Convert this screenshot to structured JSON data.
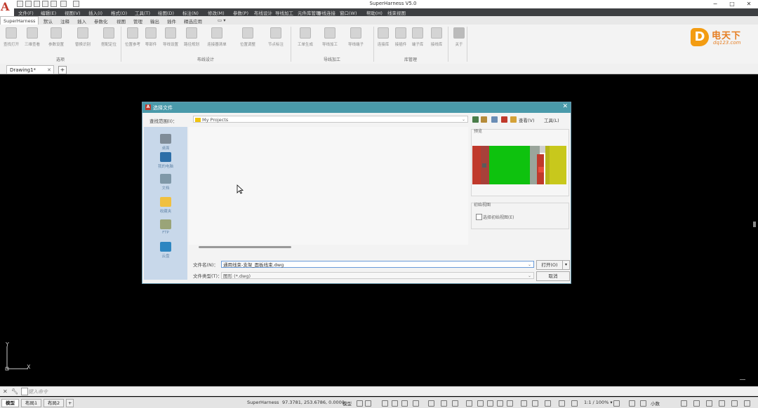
{
  "app": {
    "title": "SuperHarness V5.0",
    "window_controls": [
      "−",
      "□",
      "✕"
    ]
  },
  "menubar": [
    "文件(F)",
    "编辑(E)",
    "视图(V)",
    "插入(I)",
    "格式(O)",
    "工具(T)",
    "绘图(D)",
    "标注(N)",
    "修改(M)",
    "参数(P)",
    "布线设计",
    "导线加工",
    "元件库管理",
    "导线连接",
    "窗口(W)",
    "帮助(H)",
    "线束视图"
  ],
  "ribbon_tabs": {
    "active": "SuperHarness",
    "items": [
      "默认",
      "注释",
      "插入",
      "参数化",
      "视图",
      "管理",
      "输出",
      "插件",
      "精选应用",
      "▭ ▾"
    ]
  },
  "ribbon": {
    "buttons": [
      "查找打开",
      "三维查看",
      "参数设置",
      "替换识别",
      "搭配定位",
      "位置参考",
      "零部件",
      "导线设置",
      "路径规划",
      "连接器清单",
      "位置调整",
      "节点标注",
      "工单生成",
      "导线加工",
      "导线端子",
      "连接库",
      "接插件",
      "端子库",
      "接线库",
      "关于"
    ],
    "groups": [
      "选项",
      "布线设计",
      "导线加工",
      "库管理"
    ]
  },
  "brand": {
    "glyph": "D",
    "name": "电天下",
    "url": "dq123.com"
  },
  "drawing_tab": {
    "label": "Drawing1*",
    "close": "✕",
    "add": "+"
  },
  "dialog": {
    "title": "选择文件",
    "close": "✕",
    "look_in_label": "查找范围(I)：",
    "look_in_value": "My Projects",
    "view_label": "查看(V)",
    "tools_label": "工具(L)",
    "places": [
      "桌面",
      "我的电脑",
      "文档",
      "收藏夹",
      "FTP",
      "云盘"
    ],
    "preview_label": "预览",
    "initial_view_label": "初始视图",
    "select_initial_view": "选择初始视图(E)",
    "file_name_label": "文件名(N)：",
    "file_name_value": "通用线束-支架_面板线束.dwg",
    "file_type_label": "文件类型(T)：",
    "file_type_value": "图形 (*.dwg)",
    "open_button": "打开(O)",
    "open_dropdown": "▾",
    "cancel_button": "取消"
  },
  "command_line": {
    "prompt": "键入命令"
  },
  "status_bar": {
    "layout_tabs": [
      "模型",
      "布局1",
      "布局2"
    ],
    "add_tab": "+",
    "app_name": "SuperHarness",
    "coordinates": "97.3781, 253.6786, 0.0000",
    "space": "模型",
    "scale": "1:1 / 100% ▾",
    "units": "小数"
  },
  "ucs": {
    "x": "X",
    "y": "Y"
  },
  "colors": {
    "dialog_title_bg": "#4a9aaa",
    "places_bg": "#c8d8ea",
    "brand_orange": "#e67e22",
    "canvas_bg": "#000000"
  }
}
